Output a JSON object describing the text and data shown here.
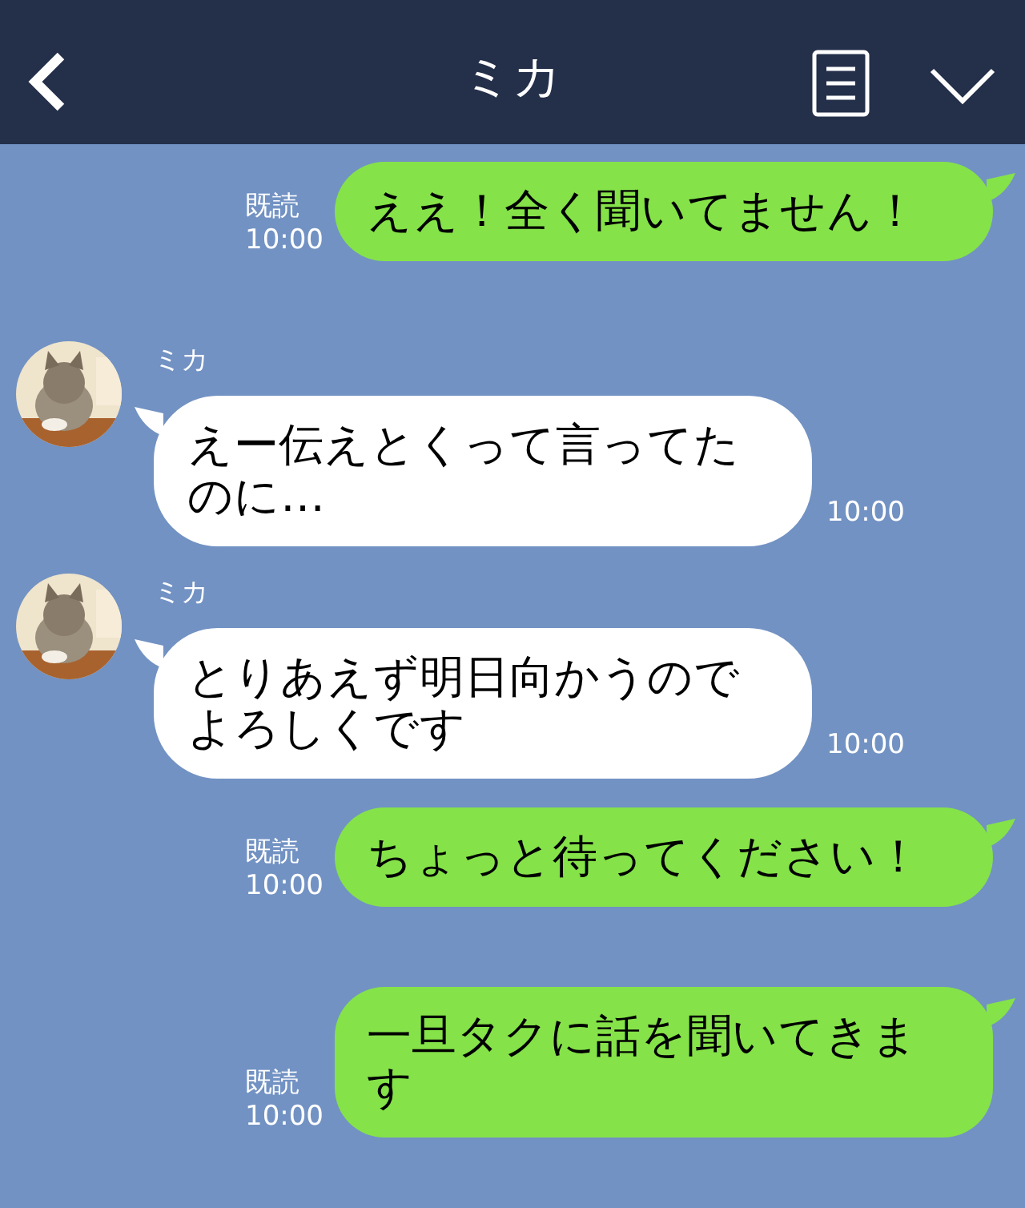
{
  "header": {
    "title": "ミカ"
  },
  "messages": [
    {
      "kind": "sent",
      "text": "ええ！全く聞いてません！",
      "read": "既読",
      "time": "10:00"
    },
    {
      "kind": "received",
      "name": "ミカ",
      "text": "えー伝えとくって言ってたのに…",
      "time": "10:00"
    },
    {
      "kind": "received",
      "name": "ミカ",
      "text": "とりあえず明日向かうのでよろしくです",
      "time": "10:00"
    },
    {
      "kind": "sent",
      "text": "ちょっと待ってください！",
      "read": "既読",
      "time": "10:00"
    },
    {
      "kind": "sent",
      "text": "一旦タクに話を聞いてきます",
      "read": "既読",
      "time": "10:00"
    }
  ]
}
